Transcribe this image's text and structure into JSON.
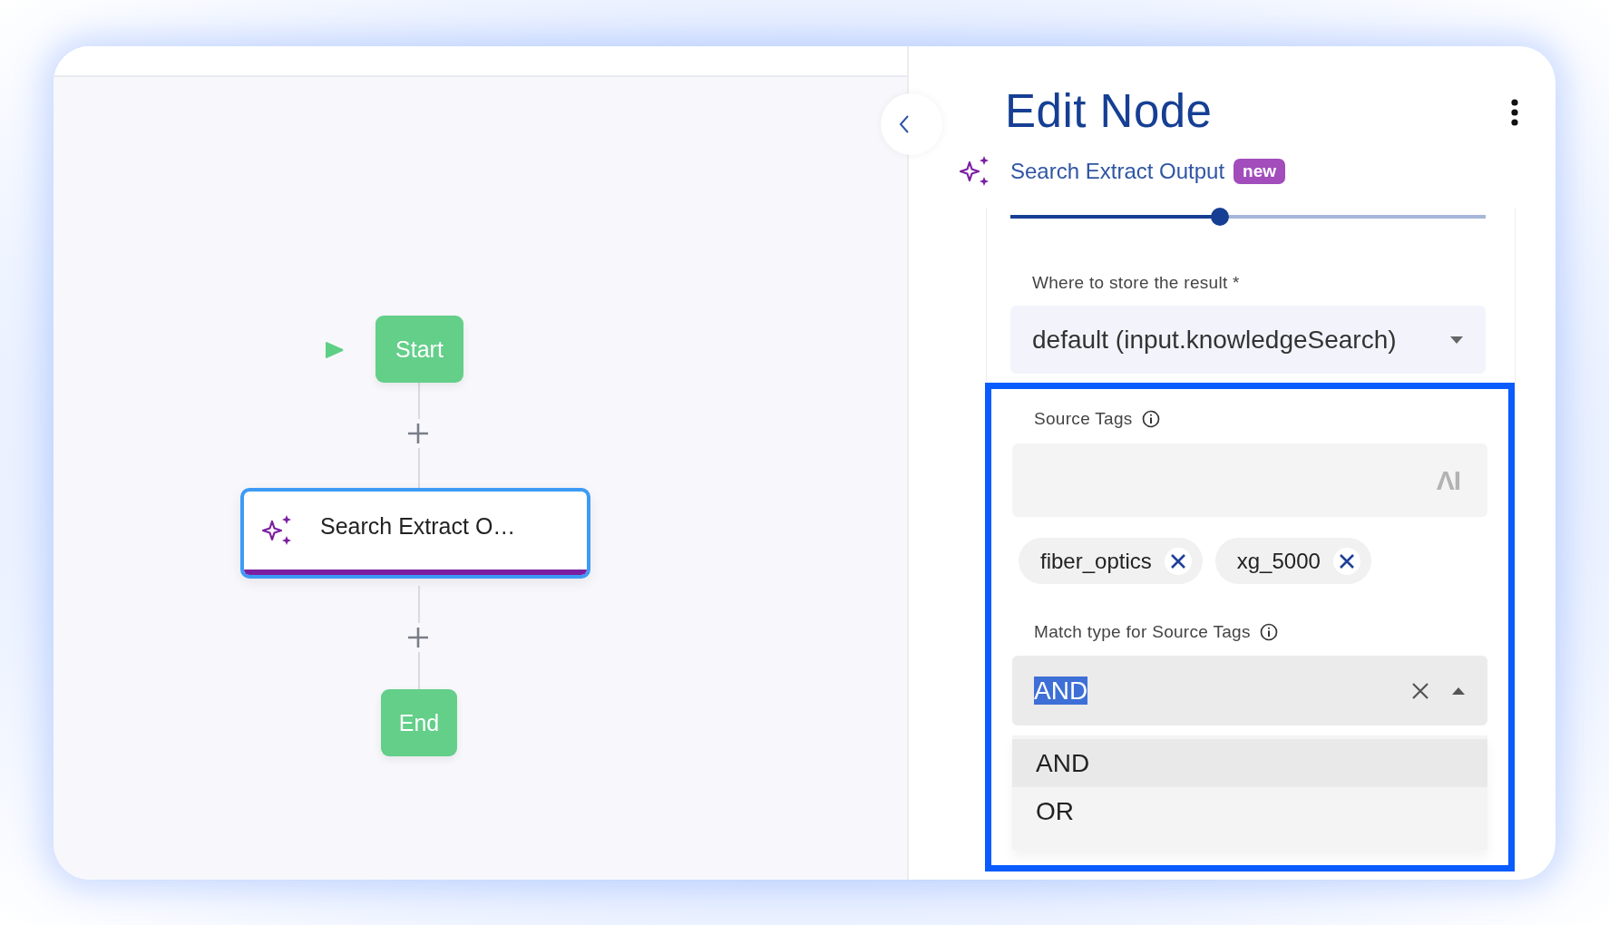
{
  "canvas": {
    "nodes": [
      {
        "kind": "start",
        "label": "Start"
      },
      {
        "kind": "add"
      },
      {
        "kind": "action",
        "label": "Search Extract O…",
        "selected": true
      },
      {
        "kind": "add"
      },
      {
        "kind": "end",
        "label": "End"
      }
    ]
  },
  "panel": {
    "title": "Edit Node",
    "node_type": "Search Extract Output",
    "badge": "new",
    "slider": {
      "level": 0.44
    },
    "store_result": {
      "label": "Where to store the result *",
      "value": "default (input.knowledgeSearch)"
    },
    "source_tags": {
      "label": "Source Tags",
      "icon_text": "ΛI",
      "chips": [
        "fiber_optics",
        "xg_5000"
      ]
    },
    "match_type": {
      "label": "Match type for Source Tags",
      "value": "AND",
      "value_selected": true,
      "expanded": true,
      "options": [
        {
          "label": "AND",
          "selected": true
        },
        {
          "label": "OR",
          "selected": false
        }
      ]
    }
  }
}
